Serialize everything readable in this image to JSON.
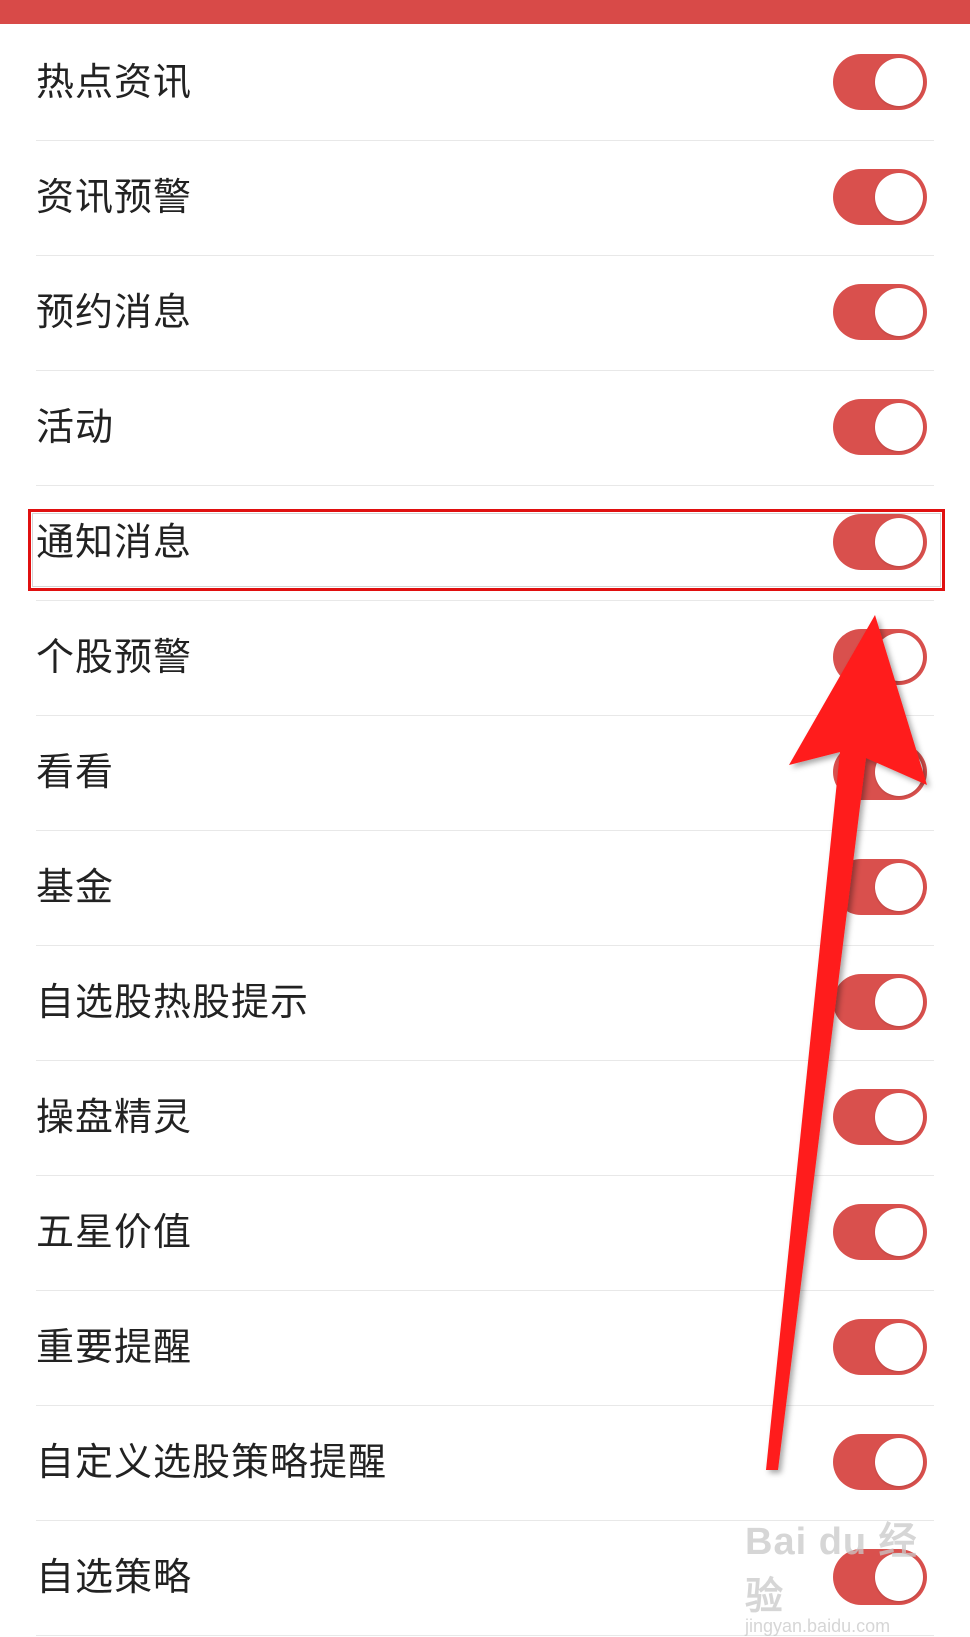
{
  "settings": {
    "items": [
      {
        "label": "热点资讯",
        "enabled": true
      },
      {
        "label": "资讯预警",
        "enabled": true
      },
      {
        "label": "预约消息",
        "enabled": true
      },
      {
        "label": "活动",
        "enabled": true
      },
      {
        "label": "通知消息",
        "enabled": true
      },
      {
        "label": "个股预警",
        "enabled": true
      },
      {
        "label": "看看",
        "enabled": true
      },
      {
        "label": "基金",
        "enabled": true
      },
      {
        "label": "自选股热股提示",
        "enabled": true
      },
      {
        "label": "操盘精灵",
        "enabled": true
      },
      {
        "label": "五星价值",
        "enabled": true
      },
      {
        "label": "重要提醒",
        "enabled": true
      },
      {
        "label": "自定义选股策略提醒",
        "enabled": true
      },
      {
        "label": "自选策略",
        "enabled": true
      }
    ]
  },
  "watermark": {
    "logo": "Bai du 经验",
    "sub": "jingyan.baidu.com"
  },
  "colors": {
    "accent": "#d84a48",
    "toggle_on": "#d9504d",
    "highlight": "#e01010",
    "arrow": "#ff1a1a"
  },
  "icons": {
    "annotation_arrow": "arrow-up-icon"
  }
}
